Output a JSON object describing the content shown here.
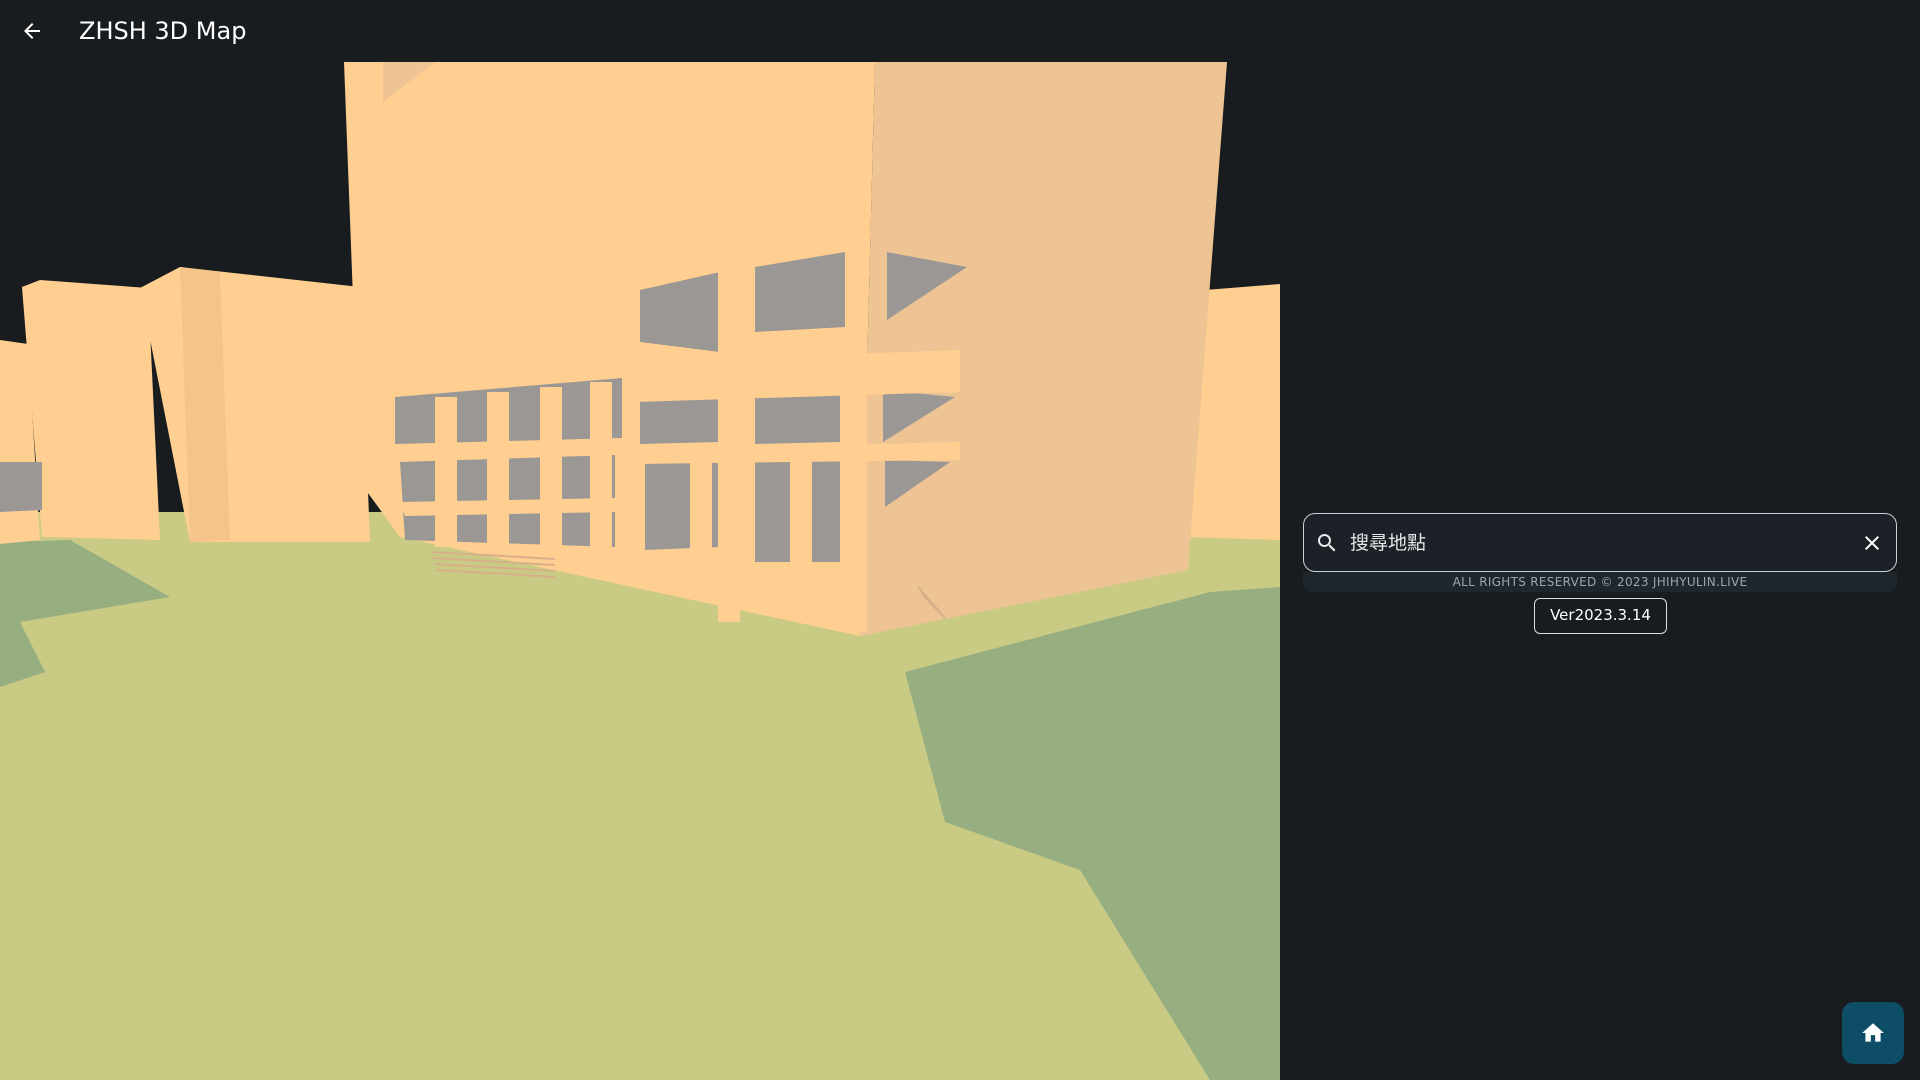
{
  "header": {
    "title": "ZHSH 3D Map",
    "back_icon": "arrow-left-icon"
  },
  "search": {
    "placeholder": "搜尋地點",
    "value": "",
    "search_icon": "search-icon",
    "clear_icon": "close-icon"
  },
  "footer": {
    "copyright": "ALL RIGHTS RESERVED © 2023 JHIHYULIN.LIVE",
    "version": "Ver2023.3.14"
  },
  "home_button": {
    "icon": "home-icon"
  },
  "colors": {
    "background": "#181c1f",
    "building": "#ffcf91",
    "ground": "#c9cb85",
    "grass": "#97ae80",
    "shadow": "#9a9794",
    "accent": "#0d4d66"
  }
}
